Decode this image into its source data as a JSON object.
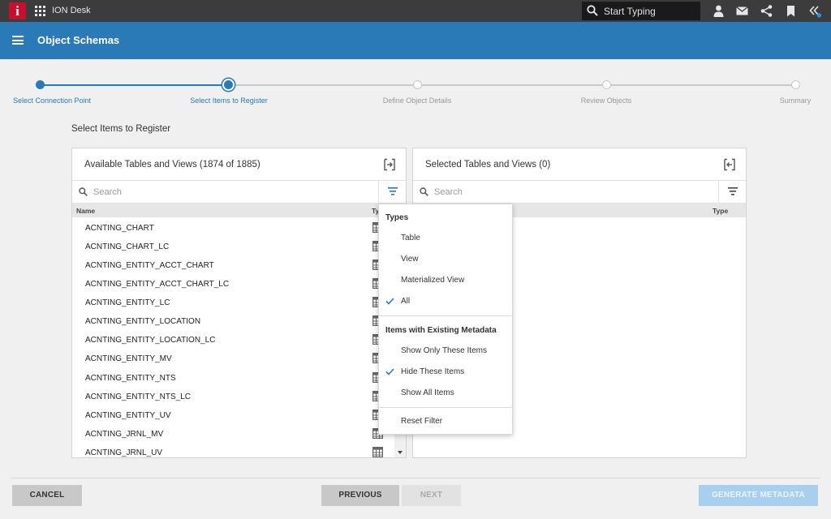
{
  "app": {
    "name": "ION Desk",
    "logo_letter": "i"
  },
  "topbar": {
    "search_placeholder": "Start Typing",
    "icons": [
      "user-icon",
      "mail-icon",
      "share-icon",
      "bookmark-icon",
      "collapse-icon"
    ],
    "notification_color": "#2f8fd8"
  },
  "header": {
    "title": "Object Schemas",
    "background": "#2a7ab8"
  },
  "stepper": {
    "steps": [
      {
        "label": "Select Connection Point",
        "state": "complete"
      },
      {
        "label": "Select Items to Register",
        "state": "current"
      },
      {
        "label": "Define Object Details",
        "state": "pending"
      },
      {
        "label": "Review Objects",
        "state": "pending"
      },
      {
        "label": "Summary",
        "state": "pending"
      }
    ],
    "active_color": "#2a7ab8",
    "pending_color": "#c8c8c8"
  },
  "section_title": "Select Items to Register",
  "left_panel": {
    "title": "Available Tables and Views (1874 of 1885)",
    "search_placeholder": "Search",
    "col_name": "Name",
    "col_type": "Ty",
    "rows": [
      "ACNTING_CHART",
      "ACNTING_CHART_LC",
      "ACNTING_ENTITY_ACCT_CHART",
      "ACNTING_ENTITY_ACCT_CHART_LC",
      "ACNTING_ENTITY_LC",
      "ACNTING_ENTITY_LOCATION",
      "ACNTING_ENTITY_LOCATION_LC",
      "ACNTING_ENTITY_MV",
      "ACNTING_ENTITY_NTS",
      "ACNTING_ENTITY_NTS_LC",
      "ACNTING_ENTITY_UV",
      "ACNTING_JRNL_MV",
      "ACNTING_JRNL_UV"
    ]
  },
  "right_panel": {
    "title": "Selected Tables and Views (0)",
    "search_placeholder": "Search",
    "col_type": "Type"
  },
  "filter_menu": {
    "types_heading": "Types",
    "types": [
      {
        "label": "Table",
        "checked": false
      },
      {
        "label": "View",
        "checked": false
      },
      {
        "label": "Materialized View",
        "checked": false
      },
      {
        "label": "All",
        "checked": true
      }
    ],
    "metadata_heading": "Items with Existing Metadata",
    "metadata_options": [
      {
        "label": "Show Only These Items",
        "checked": false
      },
      {
        "label": "Hide These Items",
        "checked": true
      },
      {
        "label": "Show All Items",
        "checked": false
      }
    ],
    "reset_label": "Reset Filter"
  },
  "footer": {
    "cancel": "CANCEL",
    "previous": "PREVIOUS",
    "next": "NEXT",
    "generate": "GENERATE METADATA"
  }
}
